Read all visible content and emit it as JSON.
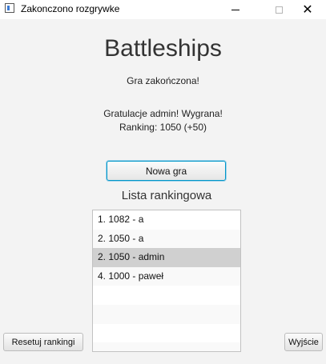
{
  "window": {
    "title": "Zakonczono rozgrywke",
    "close_glyph": "✕"
  },
  "main": {
    "title": "Battleships",
    "status": "Gra zakończona!",
    "congrats": "Gratulacje admin! Wygrana!",
    "ranking": "Ranking: 1050 (+50)",
    "new_game_label": "Nowa gra",
    "list_title": "Lista rankingowa"
  },
  "ranking_list": {
    "items": [
      {
        "text": "1. 1082 - a",
        "selected": false
      },
      {
        "text": "2. 1050 - a",
        "selected": false
      },
      {
        "text": "2. 1050 - admin",
        "selected": true
      },
      {
        "text": "4. 1000 - paweł",
        "selected": false
      }
    ],
    "empty_rows": 4
  },
  "footer": {
    "reset_label": "Resetuj rankingi",
    "exit_label": "Wyjście"
  }
}
